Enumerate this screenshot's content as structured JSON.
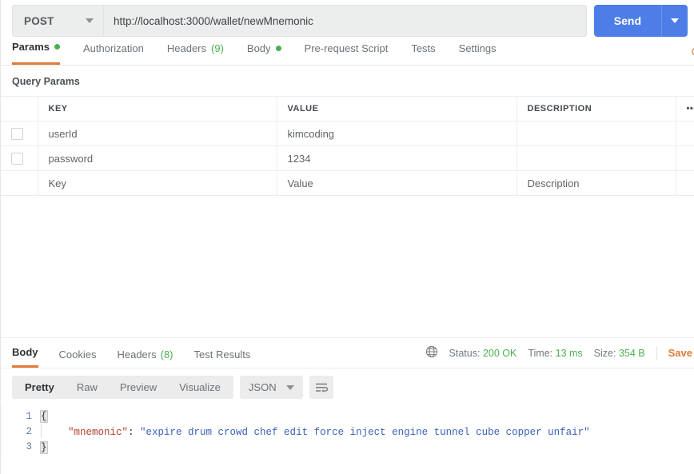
{
  "request": {
    "method": "POST",
    "url": "http://localhost:3000/wallet/newMnemonic",
    "send_label": "Send",
    "tabs": [
      {
        "label": "Params",
        "indicator": "dot",
        "active": true
      },
      {
        "label": "Authorization",
        "indicator": "",
        "active": false
      },
      {
        "label": "Headers",
        "indicator": "(9)",
        "active": false
      },
      {
        "label": "Body",
        "indicator": "dot",
        "active": false
      },
      {
        "label": "Pre-request Script",
        "indicator": "",
        "active": false
      },
      {
        "label": "Tests",
        "indicator": "",
        "active": false
      },
      {
        "label": "Settings",
        "indicator": "",
        "active": false
      }
    ],
    "cookies_link": "C"
  },
  "query_params": {
    "title": "Query Params",
    "columns": [
      "KEY",
      "VALUE",
      "DESCRIPTION"
    ],
    "rows": [
      {
        "checked": false,
        "key": "userId",
        "value": "kimcoding",
        "description": "",
        "is_placeholder": false
      },
      {
        "checked": false,
        "key": "password",
        "value": "1234",
        "description": "",
        "is_placeholder": false
      },
      {
        "checked": false,
        "key": "Key",
        "value": "Value",
        "description": "Description",
        "is_placeholder": true
      }
    ],
    "more_icon": "•••"
  },
  "response": {
    "tabs": [
      {
        "label": "Body",
        "indicator": "",
        "active": true
      },
      {
        "label": "Cookies",
        "indicator": "",
        "active": false
      },
      {
        "label": "Headers",
        "indicator": "(8)",
        "active": false
      },
      {
        "label": "Test Results",
        "indicator": "",
        "active": false
      }
    ],
    "status_label": "Status:",
    "status_value": "200 OK",
    "time_label": "Time:",
    "time_value": "13 ms",
    "size_label": "Size:",
    "size_value": "354 B",
    "save_label": "Save",
    "view_modes": [
      "Pretty",
      "Raw",
      "Preview",
      "Visualize"
    ],
    "active_view_mode": "Pretty",
    "format": "JSON",
    "body_lines": [
      "1",
      "2",
      "3"
    ],
    "json_key": "\"mnemonic\"",
    "json_value": "\"expire drum crowd chef edit force inject engine tunnel cube copper unfair\"",
    "open_brace": "{",
    "close_brace": "}",
    "colon": ": "
  },
  "colors": {
    "accent_orange": "#e07b39",
    "send_blue": "#4d7ee8",
    "status_green": "#4caf50",
    "json_key_red": "#b5402f",
    "json_string_blue": "#3a62b8"
  }
}
